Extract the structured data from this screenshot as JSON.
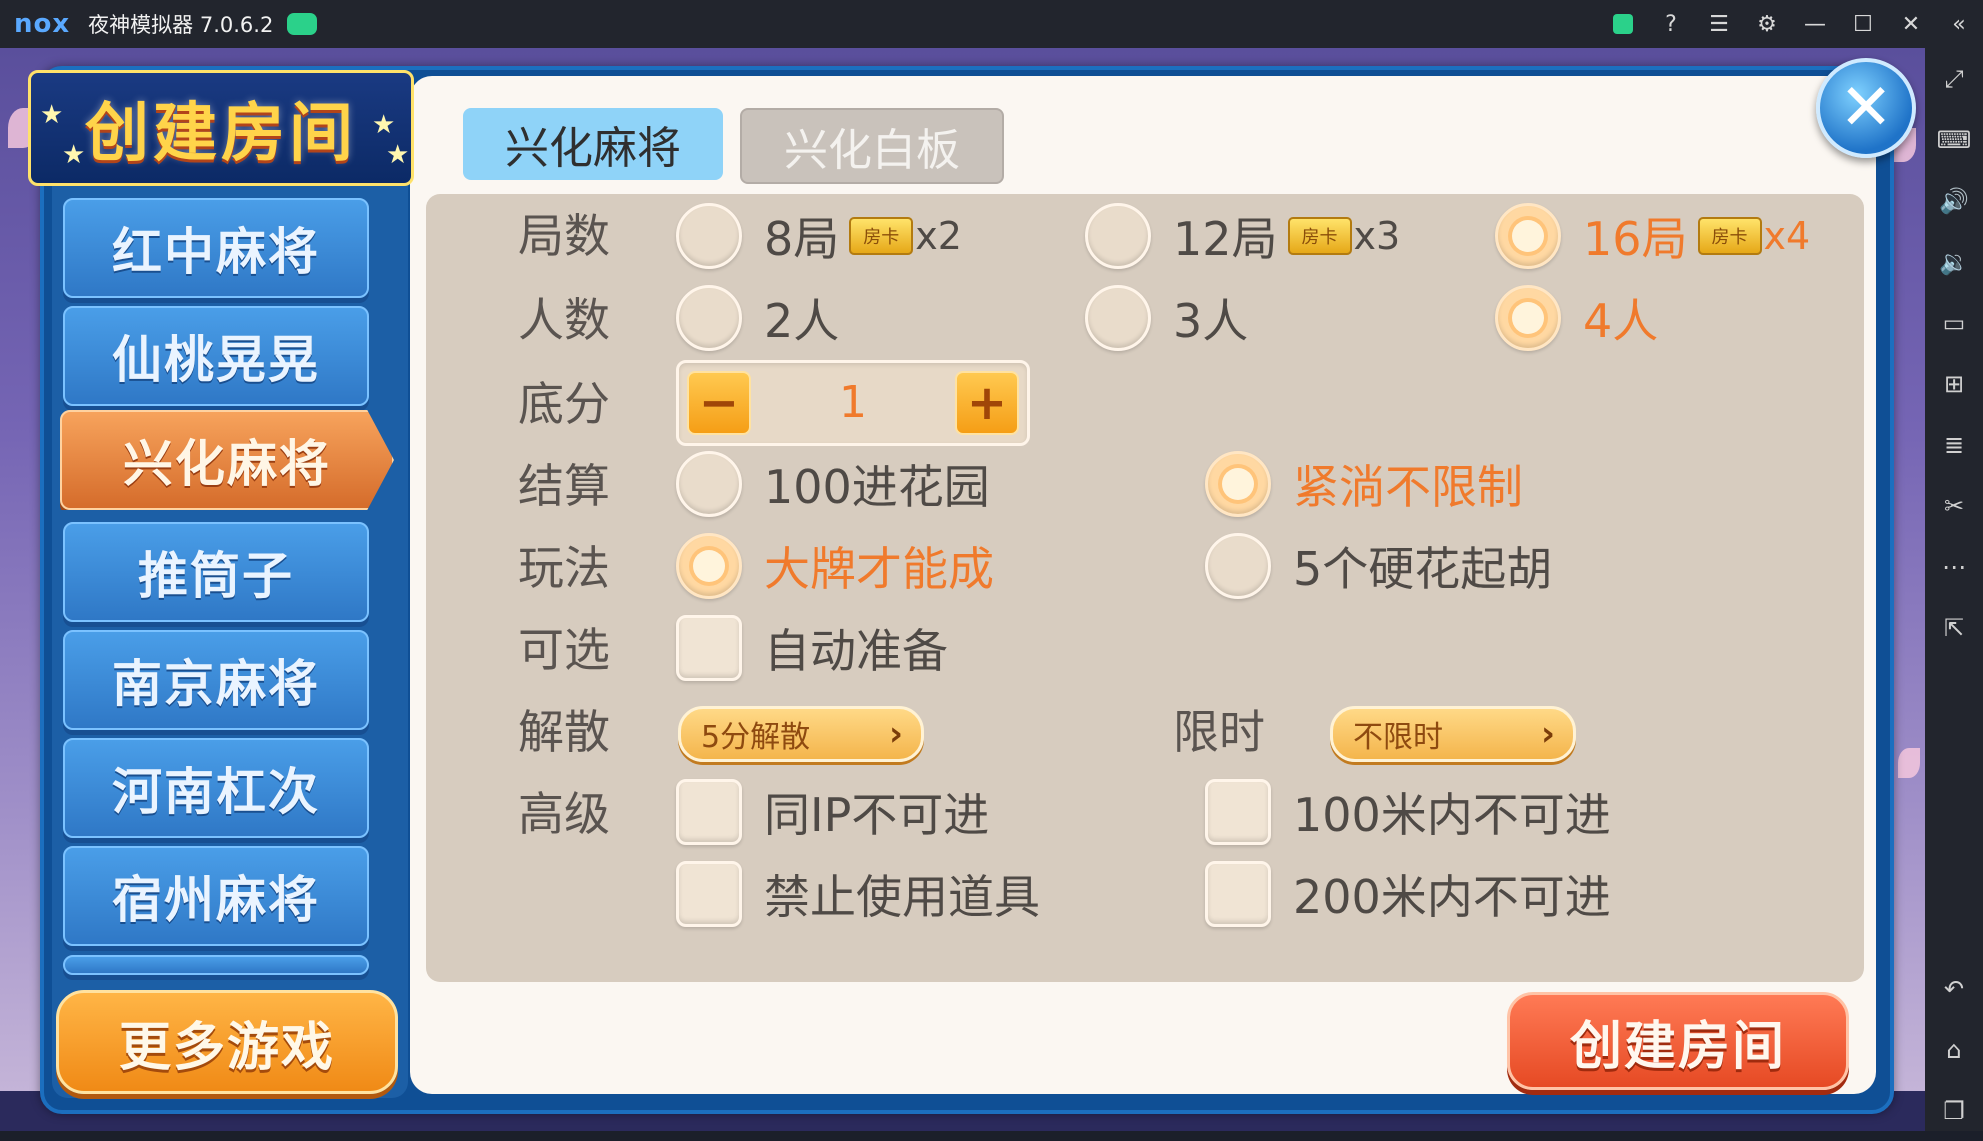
{
  "titlebar": {
    "logo": "nox",
    "title": "夜神模拟器 7.0.6.2",
    "icons": [
      "gamepad-icon",
      "store-icon",
      "help-icon",
      "menu-icon",
      "settings-icon",
      "minimize-icon",
      "maximize-icon",
      "close-icon",
      "collapse-icon"
    ]
  },
  "sidebar": {
    "icons": [
      "fullscreen-icon",
      "keyboard-icon",
      "volume-up-icon",
      "volume-down-icon",
      "screen-icon",
      "apk-install-icon",
      "multi-instance-icon",
      "scissors-icon",
      "more-icon",
      "share-icon",
      "back-icon",
      "home-icon",
      "recent-apps-icon"
    ]
  },
  "dialog": {
    "title": "创建房间",
    "close_label": "✕",
    "games": [
      "红中麻将",
      "仙桃晃晃",
      "兴化麻将",
      "推筒子",
      "南京麻将",
      "河南杠次",
      "宿州麻将"
    ],
    "active_game": "兴化麻将",
    "more_games": "更多游戏",
    "tabs": [
      "兴化麻将",
      "兴化白板"
    ],
    "active_tab": "兴化麻将",
    "create_button": "创建房间"
  },
  "options": {
    "rounds": {
      "label": "局数",
      "choices": [
        {
          "text": "8局",
          "card": "房卡",
          "mult": "x2",
          "selected": false
        },
        {
          "text": "12局",
          "card": "房卡",
          "mult": "x3",
          "selected": false
        },
        {
          "text": "16局",
          "card": "房卡",
          "mult": "x4",
          "selected": true
        }
      ]
    },
    "players": {
      "label": "人数",
      "choices": [
        {
          "text": "2人",
          "selected": false
        },
        {
          "text": "3人",
          "selected": false
        },
        {
          "text": "4人",
          "selected": true
        }
      ]
    },
    "base_score": {
      "label": "底分",
      "value": "1",
      "minus": "−",
      "plus": "+"
    },
    "settlement": {
      "label": "结算",
      "choices": [
        {
          "text": "100进花园",
          "selected": false
        },
        {
          "text": "紧淌不限制",
          "selected": true
        }
      ]
    },
    "rules": {
      "label": "玩法",
      "choices": [
        {
          "text": "大牌才能成",
          "selected": true
        },
        {
          "text": "5个硬花起胡",
          "selected": false
        }
      ]
    },
    "optional": {
      "label": "可选",
      "choices": [
        {
          "text": "自动准备",
          "checked": false
        }
      ]
    },
    "dissolve": {
      "label": "解散",
      "value": "5分解散"
    },
    "time_limit": {
      "label": "限时",
      "value": "不限时"
    },
    "advanced": {
      "label": "高级",
      "choices": [
        {
          "text": "同IP不可进",
          "checked": false
        },
        {
          "text": "100米内不可进",
          "checked": false
        },
        {
          "text": "禁止使用道具",
          "checked": false
        },
        {
          "text": "200米内不可进",
          "checked": false
        }
      ]
    }
  },
  "colors": {
    "selected_text": "#f07a2c",
    "panel_bg": "#d7ccbf",
    "tab_active": "#8fd3f8",
    "frame_blue": "#0f4f95"
  }
}
